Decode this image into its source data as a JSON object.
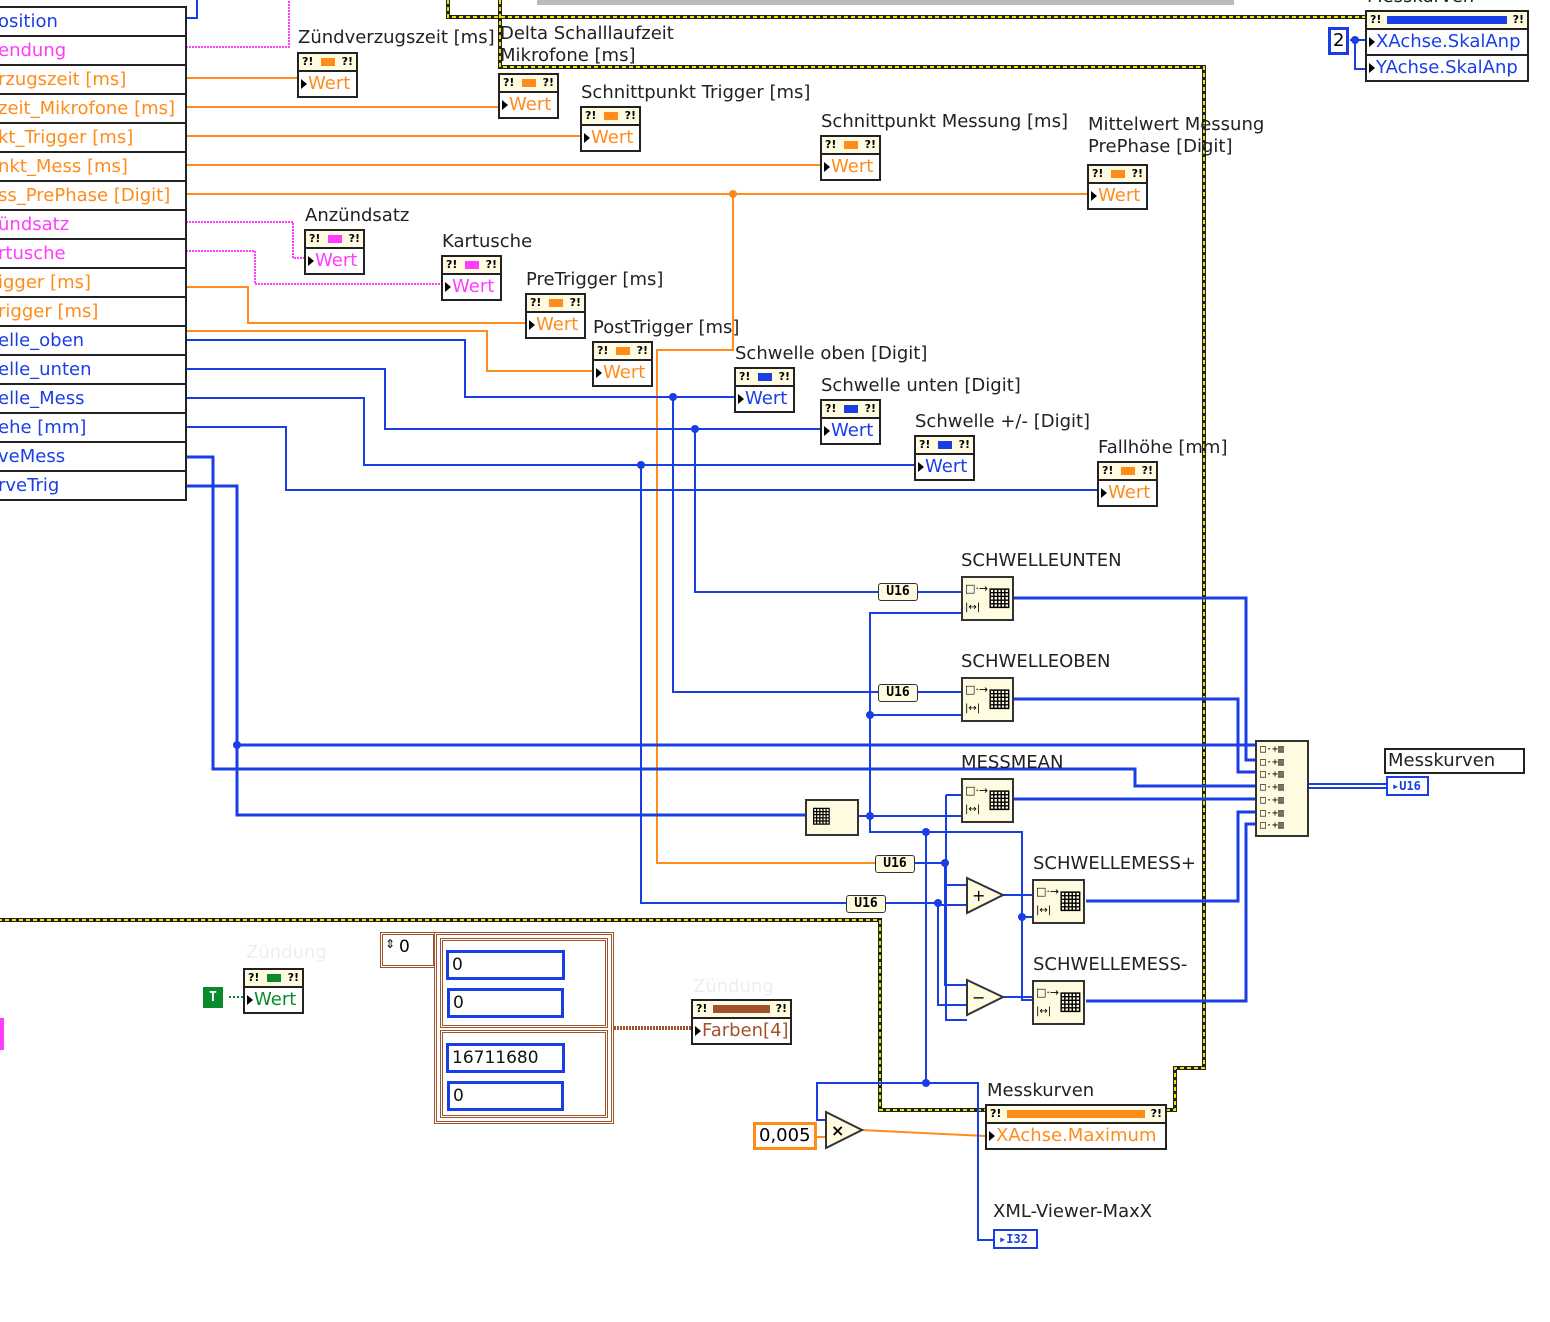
{
  "cluster_rows": [
    {
      "label": "osition",
      "color": "#1a3ee6"
    },
    {
      "label": "endung",
      "color": "#ff3cff"
    },
    {
      "label": "rzugszeit [ms]",
      "color": "#ff8c1a"
    },
    {
      "label": "zeit_Mikrofone [ms]",
      "color": "#ff8c1a"
    },
    {
      "label": "kt_Trigger [ms]",
      "color": "#ff8c1a"
    },
    {
      "label": "nkt_Mess [ms]",
      "color": "#ff8c1a"
    },
    {
      "label": "ss_PrePhase [Digit]",
      "color": "#ff8c1a"
    },
    {
      "label": "ündsatz",
      "color": "#ff3cff"
    },
    {
      "label": "rtusche",
      "color": "#ff3cff"
    },
    {
      "label": "igger [ms]",
      "color": "#ff8c1a"
    },
    {
      "label": "rigger [ms]",
      "color": "#ff8c1a"
    },
    {
      "label": "elle_oben",
      "color": "#1a3ee6"
    },
    {
      "label": "elle_unten",
      "color": "#1a3ee6"
    },
    {
      "label": "elle_Mess",
      "color": "#1a3ee6"
    },
    {
      "label": "ehe [mm]",
      "color": "#1a3ee6"
    },
    {
      "label": "veMess",
      "color": "#1a3ee6"
    },
    {
      "label": "rveTrig",
      "color": "#1a3ee6"
    }
  ],
  "property_nodes": [
    {
      "label": "Zündverzugszeit [ms]",
      "props": [
        "Wert"
      ],
      "color": "#ff8c1a"
    },
    {
      "label": "Delta Schalllaufzeit\nMikrofone [ms]",
      "props": [
        "Wert"
      ],
      "color": "#ff8c1a"
    },
    {
      "label": "Schnittpunkt Trigger [ms]",
      "props": [
        "Wert"
      ],
      "color": "#ff8c1a"
    },
    {
      "label": "Schnittpunkt Messung [ms]",
      "props": [
        "Wert"
      ],
      "color": "#ff8c1a"
    },
    {
      "label": "Mittelwert Messung\nPrePhase [Digit]",
      "props": [
        "Wert"
      ],
      "color": "#ff8c1a"
    },
    {
      "label": "Anzündsatz",
      "props": [
        "Wert"
      ],
      "color": "#ff3cff"
    },
    {
      "label": "Kartusche",
      "props": [
        "Wert"
      ],
      "color": "#ff3cff"
    },
    {
      "label": "PreTrigger [ms]",
      "props": [
        "Wert"
      ],
      "color": "#ff8c1a"
    },
    {
      "label": "PostTrigger [ms]",
      "props": [
        "Wert"
      ],
      "color": "#ff8c1a"
    },
    {
      "label": "Schwelle oben [Digit]",
      "props": [
        "Wert"
      ],
      "color": "#1a3ee6"
    },
    {
      "label": "Schwelle unten [Digit]",
      "props": [
        "Wert"
      ],
      "color": "#1a3ee6"
    },
    {
      "label": "Schwelle +/- [Digit]",
      "props": [
        "Wert"
      ],
      "color": "#1a3ee6"
    },
    {
      "label": "Fallhöhe [mm]",
      "props": [
        "Wert"
      ],
      "color": "#ff8c1a"
    },
    {
      "label": "Zündung",
      "props": [
        "Wert"
      ],
      "color": "#0a8a2a"
    },
    {
      "label": "Zündung",
      "props": [
        "Farben[4]"
      ],
      "color": "#a0522d"
    },
    {
      "label": "Messkurven",
      "props": [
        "XAchse.Maximum"
      ],
      "color": "#ff8c1a"
    },
    {
      "label": "Messkurven",
      "props": [
        "XAchse.SkalAnp",
        "YAchse.SkalAnp"
      ],
      "color": "#1a3ee6"
    }
  ],
  "bundle_nodes": [
    "SCHWELLEUNTEN",
    "SCHWELLEOBEN",
    "MESSMEAN",
    "SCHWELLEMESS+",
    "SCHWELLEMESS-"
  ],
  "conversions": [
    "U16",
    "U16",
    "U16",
    "U16"
  ],
  "constants": {
    "multiplier": "0,005",
    "skal_anp": "2",
    "boolean": "T",
    "array_index": "0",
    "array_values": [
      "0",
      "0",
      "16711680",
      "0"
    ]
  },
  "indicators": {
    "messkurven_label": "Messkurven",
    "messkurven_type": "U16",
    "xml_label": "XML-Viewer-MaxX",
    "xml_type": "I32"
  },
  "operators": {
    "add": "+",
    "subtract": "−",
    "multiply": "×"
  },
  "colors": {
    "integer": "#1a3ee6",
    "float": "#ff8c1a",
    "string": "#ff3cff",
    "boolean": "#0a8a2a",
    "cluster": "#a0522d",
    "structure": "#d4d400"
  }
}
